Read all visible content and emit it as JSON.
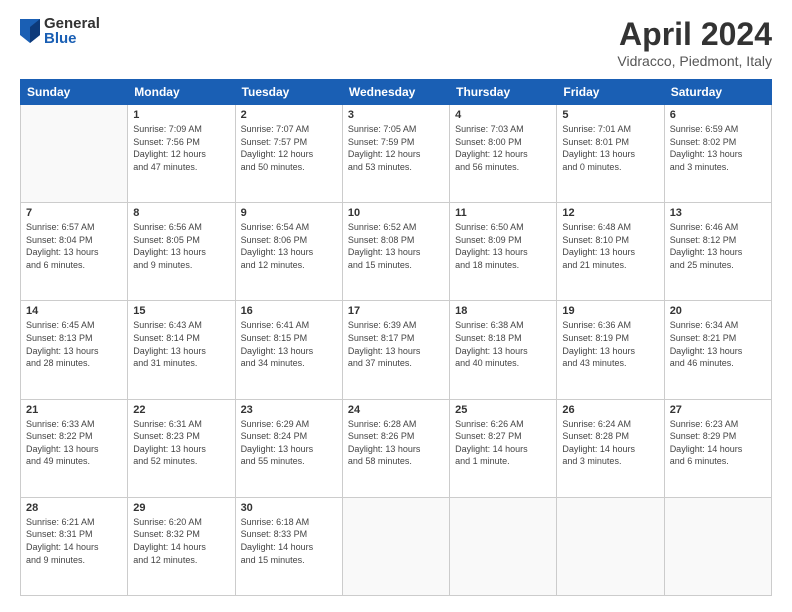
{
  "logo": {
    "general": "General",
    "blue": "Blue"
  },
  "header": {
    "title": "April 2024",
    "subtitle": "Vidracco, Piedmont, Italy"
  },
  "days_of_week": [
    "Sunday",
    "Monday",
    "Tuesday",
    "Wednesday",
    "Thursday",
    "Friday",
    "Saturday"
  ],
  "weeks": [
    [
      {
        "day": "",
        "info": ""
      },
      {
        "day": "1",
        "info": "Sunrise: 7:09 AM\nSunset: 7:56 PM\nDaylight: 12 hours\nand 47 minutes."
      },
      {
        "day": "2",
        "info": "Sunrise: 7:07 AM\nSunset: 7:57 PM\nDaylight: 12 hours\nand 50 minutes."
      },
      {
        "day": "3",
        "info": "Sunrise: 7:05 AM\nSunset: 7:59 PM\nDaylight: 12 hours\nand 53 minutes."
      },
      {
        "day": "4",
        "info": "Sunrise: 7:03 AM\nSunset: 8:00 PM\nDaylight: 12 hours\nand 56 minutes."
      },
      {
        "day": "5",
        "info": "Sunrise: 7:01 AM\nSunset: 8:01 PM\nDaylight: 13 hours\nand 0 minutes."
      },
      {
        "day": "6",
        "info": "Sunrise: 6:59 AM\nSunset: 8:02 PM\nDaylight: 13 hours\nand 3 minutes."
      }
    ],
    [
      {
        "day": "7",
        "info": "Sunrise: 6:57 AM\nSunset: 8:04 PM\nDaylight: 13 hours\nand 6 minutes."
      },
      {
        "day": "8",
        "info": "Sunrise: 6:56 AM\nSunset: 8:05 PM\nDaylight: 13 hours\nand 9 minutes."
      },
      {
        "day": "9",
        "info": "Sunrise: 6:54 AM\nSunset: 8:06 PM\nDaylight: 13 hours\nand 12 minutes."
      },
      {
        "day": "10",
        "info": "Sunrise: 6:52 AM\nSunset: 8:08 PM\nDaylight: 13 hours\nand 15 minutes."
      },
      {
        "day": "11",
        "info": "Sunrise: 6:50 AM\nSunset: 8:09 PM\nDaylight: 13 hours\nand 18 minutes."
      },
      {
        "day": "12",
        "info": "Sunrise: 6:48 AM\nSunset: 8:10 PM\nDaylight: 13 hours\nand 21 minutes."
      },
      {
        "day": "13",
        "info": "Sunrise: 6:46 AM\nSunset: 8:12 PM\nDaylight: 13 hours\nand 25 minutes."
      }
    ],
    [
      {
        "day": "14",
        "info": "Sunrise: 6:45 AM\nSunset: 8:13 PM\nDaylight: 13 hours\nand 28 minutes."
      },
      {
        "day": "15",
        "info": "Sunrise: 6:43 AM\nSunset: 8:14 PM\nDaylight: 13 hours\nand 31 minutes."
      },
      {
        "day": "16",
        "info": "Sunrise: 6:41 AM\nSunset: 8:15 PM\nDaylight: 13 hours\nand 34 minutes."
      },
      {
        "day": "17",
        "info": "Sunrise: 6:39 AM\nSunset: 8:17 PM\nDaylight: 13 hours\nand 37 minutes."
      },
      {
        "day": "18",
        "info": "Sunrise: 6:38 AM\nSunset: 8:18 PM\nDaylight: 13 hours\nand 40 minutes."
      },
      {
        "day": "19",
        "info": "Sunrise: 6:36 AM\nSunset: 8:19 PM\nDaylight: 13 hours\nand 43 minutes."
      },
      {
        "day": "20",
        "info": "Sunrise: 6:34 AM\nSunset: 8:21 PM\nDaylight: 13 hours\nand 46 minutes."
      }
    ],
    [
      {
        "day": "21",
        "info": "Sunrise: 6:33 AM\nSunset: 8:22 PM\nDaylight: 13 hours\nand 49 minutes."
      },
      {
        "day": "22",
        "info": "Sunrise: 6:31 AM\nSunset: 8:23 PM\nDaylight: 13 hours\nand 52 minutes."
      },
      {
        "day": "23",
        "info": "Sunrise: 6:29 AM\nSunset: 8:24 PM\nDaylight: 13 hours\nand 55 minutes."
      },
      {
        "day": "24",
        "info": "Sunrise: 6:28 AM\nSunset: 8:26 PM\nDaylight: 13 hours\nand 58 minutes."
      },
      {
        "day": "25",
        "info": "Sunrise: 6:26 AM\nSunset: 8:27 PM\nDaylight: 14 hours\nand 1 minute."
      },
      {
        "day": "26",
        "info": "Sunrise: 6:24 AM\nSunset: 8:28 PM\nDaylight: 14 hours\nand 3 minutes."
      },
      {
        "day": "27",
        "info": "Sunrise: 6:23 AM\nSunset: 8:29 PM\nDaylight: 14 hours\nand 6 minutes."
      }
    ],
    [
      {
        "day": "28",
        "info": "Sunrise: 6:21 AM\nSunset: 8:31 PM\nDaylight: 14 hours\nand 9 minutes."
      },
      {
        "day": "29",
        "info": "Sunrise: 6:20 AM\nSunset: 8:32 PM\nDaylight: 14 hours\nand 12 minutes."
      },
      {
        "day": "30",
        "info": "Sunrise: 6:18 AM\nSunset: 8:33 PM\nDaylight: 14 hours\nand 15 minutes."
      },
      {
        "day": "",
        "info": ""
      },
      {
        "day": "",
        "info": ""
      },
      {
        "day": "",
        "info": ""
      },
      {
        "day": "",
        "info": ""
      }
    ]
  ]
}
